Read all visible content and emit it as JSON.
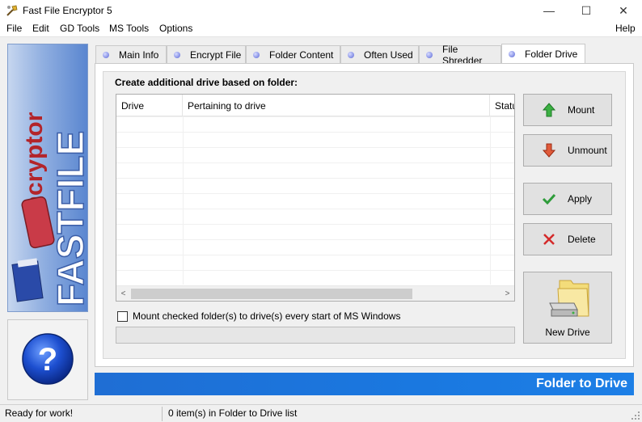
{
  "window": {
    "title": "Fast File Encryptor 5",
    "minimize": "—",
    "maximize": "☐",
    "close": "✕"
  },
  "menu": [
    {
      "label": "File"
    },
    {
      "label": "Edit"
    },
    {
      "label": "GD Tools"
    },
    {
      "label": "MS Tools"
    },
    {
      "label": "Options"
    },
    {
      "label": "Help"
    }
  ],
  "logo": {
    "line1": "encryptor",
    "line2": "FASTFILE"
  },
  "help": {
    "glyph": "?"
  },
  "tabs": [
    {
      "label": "Main Info",
      "active": false
    },
    {
      "label": "Encrypt File",
      "active": false
    },
    {
      "label": "Folder Content",
      "active": false
    },
    {
      "label": "Often Used",
      "active": false
    },
    {
      "label": "File Shredder",
      "active": false
    },
    {
      "label": "Folder Drive",
      "active": true
    }
  ],
  "group": {
    "title": "Create additional drive based on folder:"
  },
  "list": {
    "columns": [
      "Drive",
      "Pertaining to drive",
      "Status"
    ],
    "scroll_left": "<",
    "scroll_right": ">"
  },
  "checkbox": {
    "label": "Mount checked folder(s) to drive(s) every start of MS Windows",
    "checked": false
  },
  "buttons": {
    "mount": "Mount",
    "unmount": "Unmount",
    "apply": "Apply",
    "delete": "Delete",
    "new_drive": "New Drive"
  },
  "banner": {
    "text": "Folder to Drive"
  },
  "status": {
    "left": "Ready for work!",
    "right": "0 item(s) in Folder to Drive list"
  },
  "colors": {
    "banner_blue": "#1a78e0",
    "mount_green": "#3cb043",
    "unmount_red": "#e05a3a",
    "apply_green": "#2e9c3a",
    "delete_red": "#d42a2a"
  }
}
